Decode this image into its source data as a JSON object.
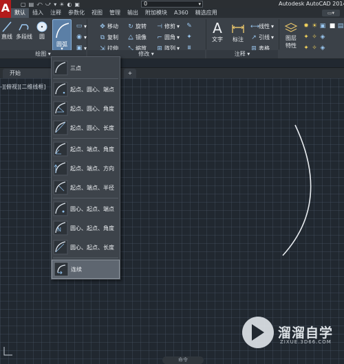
{
  "app": {
    "logo_letter": "A",
    "title": "Autodesk AutoCAD 2014",
    "layer_value": "0"
  },
  "qat": {
    "items": [
      "▢",
      "▤",
      "⤺",
      "⤻",
      "▾",
      "☀",
      "◐",
      "▣"
    ]
  },
  "ribbon": {
    "tabs": [
      "默认",
      "插入",
      "注释",
      "参数化",
      "视图",
      "管理",
      "输出",
      "附加模块",
      "A360",
      "精选应用"
    ],
    "active_tab": "默认",
    "extra_button": "▭▾",
    "draw_panel": {
      "title": "绘图",
      "title_arrow": "▾",
      "line_label": "直线",
      "polyline_label": "多段线",
      "circle_label": "圆",
      "arc_label": "圆弧",
      "arc_dropdown": "▾"
    },
    "modify_panel": {
      "title": "修改",
      "title_arrow": "▾",
      "move": "移动",
      "rotate": "旋转",
      "trim": "修剪",
      "copy": "复制",
      "mirror": "镜像",
      "fillet": "圆角",
      "stretch": "拉伸",
      "scale": "缩放",
      "array": "阵列"
    },
    "annotation_panel": {
      "title": "注释",
      "title_arrow": "▾",
      "text": "文字",
      "dimension": "标注",
      "linear": "线性",
      "leader": "引线",
      "table": "表格"
    },
    "layers_panel": {
      "properties_line1": "图层",
      "properties_line2": "特性"
    }
  },
  "filetabs": {
    "start": "开始",
    "add": "+"
  },
  "viewport": {
    "label": "-][俯视][二维线框]"
  },
  "arc_menu": {
    "items": [
      {
        "label": "三点",
        "icon": "arc-three-point-icon"
      },
      {
        "label": "起点、圆心、端点",
        "icon": "arc-start-center-end-icon"
      },
      {
        "label": "起点、圆心、角度",
        "icon": "arc-start-center-angle-icon"
      },
      {
        "label": "起点、圆心、长度",
        "icon": "arc-start-center-length-icon"
      },
      {
        "label": "起点、端点、角度",
        "icon": "arc-start-end-angle-icon"
      },
      {
        "label": "起点、端点、方向",
        "icon": "arc-start-end-direction-icon"
      },
      {
        "label": "起点、端点、半径",
        "icon": "arc-start-end-radius-icon"
      },
      {
        "label": "圆心、起点、端点",
        "icon": "arc-center-start-end-icon"
      },
      {
        "label": "圆心、起点、角度",
        "icon": "arc-center-start-angle-icon"
      },
      {
        "label": "圆心、起点、长度",
        "icon": "arc-center-start-length-icon"
      },
      {
        "label": "连续",
        "icon": "arc-continue-icon"
      }
    ],
    "highlighted": "连续"
  },
  "statusbar": {
    "command_hint": "命令"
  },
  "watermark": {
    "name": "溜溜自学",
    "url": "ZIXUE.3D66.COM"
  },
  "colors": {
    "canvas_bg": "#212830",
    "ribbon_bg": "#3b4148",
    "accent": "#5b7fa6",
    "arc_stroke": "#e8ecf0"
  }
}
